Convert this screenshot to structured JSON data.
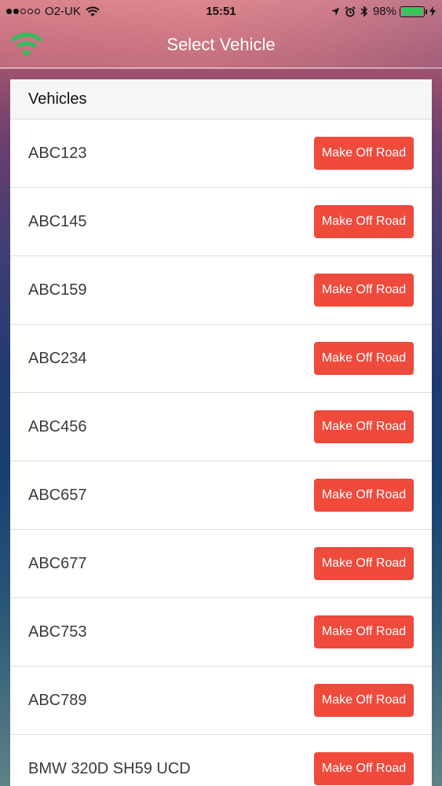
{
  "status_bar": {
    "carrier": "O2-UK",
    "time": "15:51",
    "battery_percent": "98%",
    "battery_level": 0.98,
    "icons": [
      "signal-dots-icon",
      "wifi-icon",
      "location-arrow-icon",
      "alarm-icon",
      "bluetooth-icon",
      "battery-icon",
      "charging-bolt-icon"
    ]
  },
  "nav": {
    "title": "Select Vehicle",
    "left_icon": "wifi-icon",
    "left_icon_color": "#2fbf5a"
  },
  "list": {
    "header": "Vehicles",
    "button_color": "#ef4a3c",
    "items": [
      {
        "label": "ABC123",
        "button": "Make Off Road"
      },
      {
        "label": "ABC145",
        "button": "Make Off Road"
      },
      {
        "label": "ABC159",
        "button": "Make Off Road"
      },
      {
        "label": "ABC234",
        "button": "Make Off Road"
      },
      {
        "label": "ABC456",
        "button": "Make Off Road"
      },
      {
        "label": "ABC657",
        "button": "Make Off Road"
      },
      {
        "label": "ABC677",
        "button": "Make Off Road"
      },
      {
        "label": "ABC753",
        "button": "Make Off Road"
      },
      {
        "label": "ABC789",
        "button": "Make Off Road"
      },
      {
        "label": "BMW 320D SH59 UCD",
        "button": "Make Off Road"
      }
    ]
  }
}
